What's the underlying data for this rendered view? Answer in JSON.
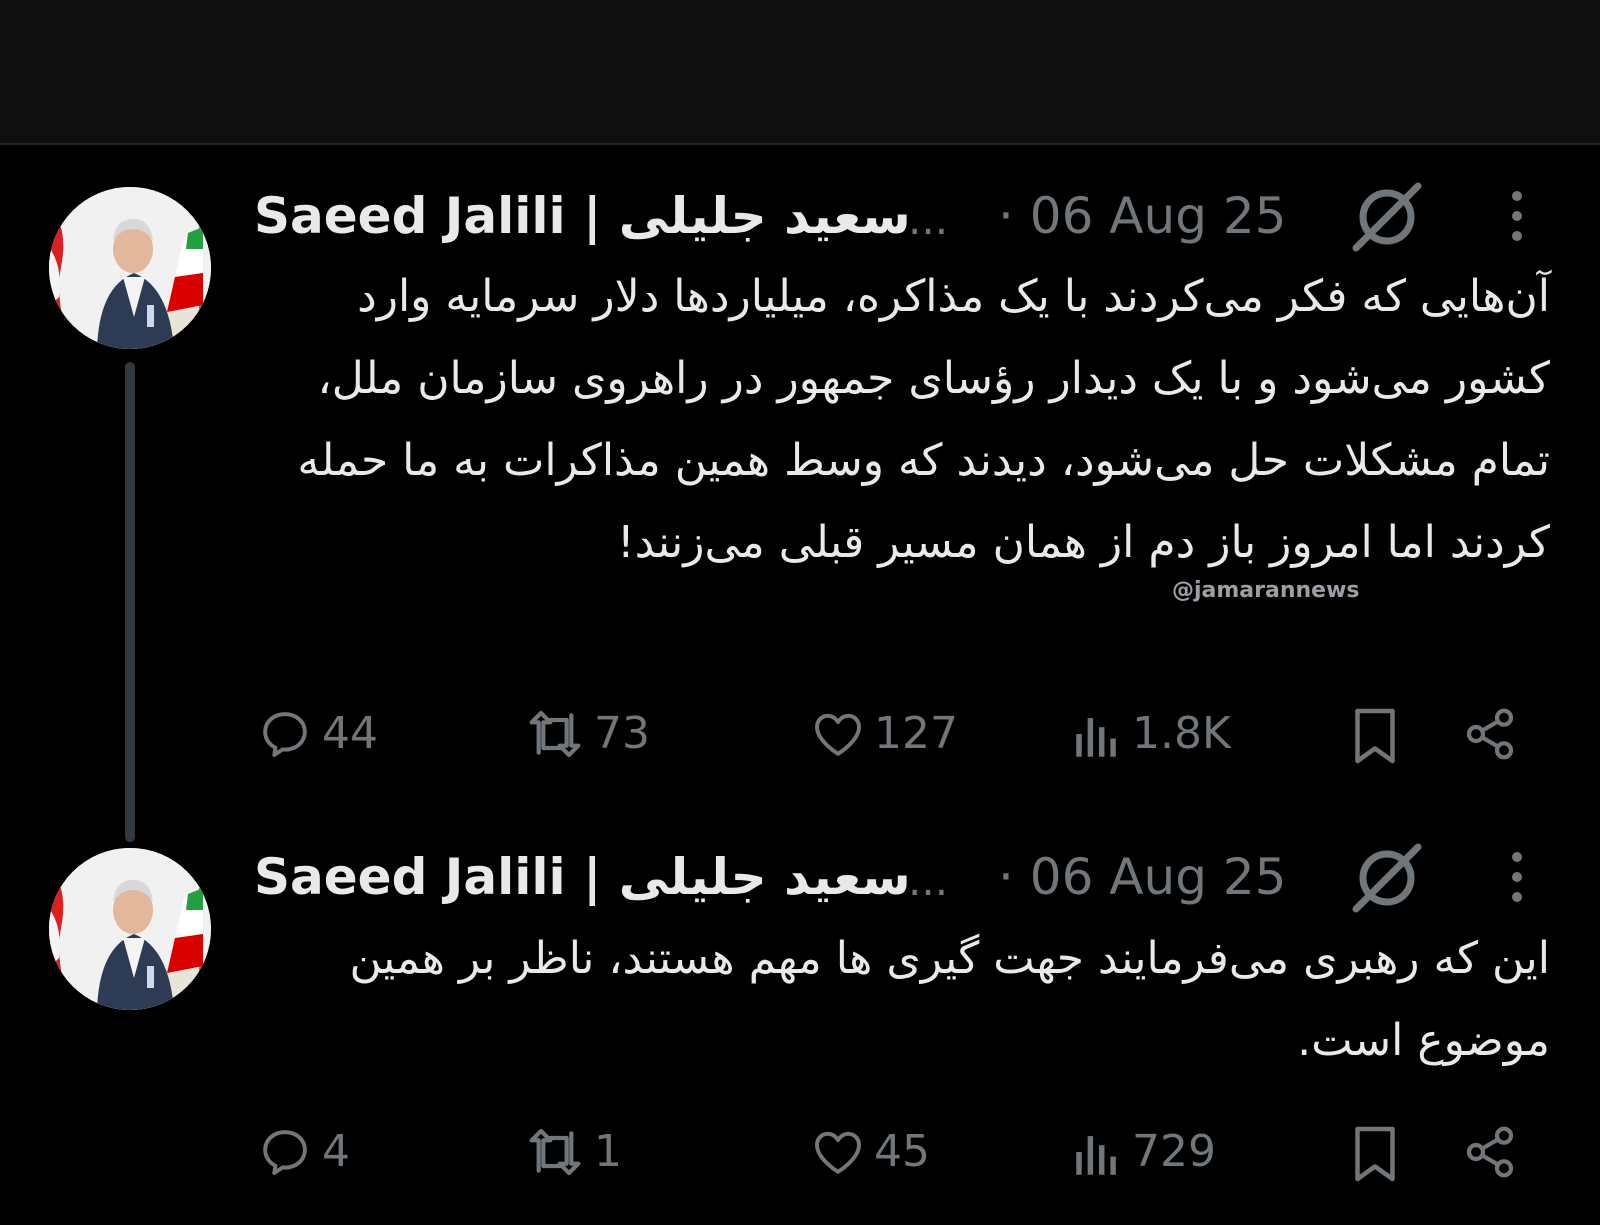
{
  "tweets": [
    {
      "author": "Saeed Jalili | سعید جلیلی",
      "truncation": "...",
      "date": "· 06 Aug 25",
      "text": "آن‌هایی که فکر می‌کردند با یک مذاکره، میلیاردها دلار سرمایه وارد کشور می‌شود و با یک دیدار رؤسای جمهور در راهروی سازمان ملل، تمام مشکلات حل می‌شود، دیدند که وسط همین مذاکرات به ما حمله کردند اما امروز باز دم از همان مسیر قبلی می‌زنند!",
      "replies": "44",
      "reposts": "73",
      "likes": "127",
      "views": "1.8K"
    },
    {
      "author": "Saeed Jalili | سعید جلیلی",
      "truncation": "...",
      "date": "· 06 Aug 25",
      "text": "این که رهبری می‌فرمایند جهت گیری ها مهم هستند، ناظر بر همین موضوع است.",
      "replies": "4",
      "reposts": "1",
      "likes": "45",
      "views": "729"
    }
  ],
  "watermark": "@jamarannews",
  "icons": [
    "grok-icon",
    "more-icon",
    "reply-icon",
    "repost-icon",
    "like-icon",
    "views-icon",
    "bookmark-icon",
    "share-icon"
  ],
  "colors": {
    "background": "#000000",
    "text": "#e7e9ea",
    "secondary": "#71767b",
    "thread_line": "#333a3f",
    "flag_green": "#239f40",
    "flag_red": "#da0000"
  }
}
